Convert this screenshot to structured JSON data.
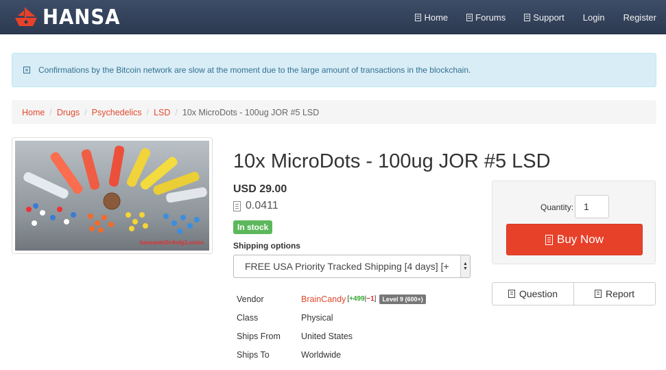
{
  "brand": {
    "name": "HANSA",
    "logo_color": "#e8412a"
  },
  "nav": [
    {
      "label": "Home",
      "icon": "page-icon"
    },
    {
      "label": "Forums",
      "icon": "page-icon"
    },
    {
      "label": "Support",
      "icon": "page-icon"
    },
    {
      "label": "Login"
    },
    {
      "label": "Register"
    }
  ],
  "alert": {
    "text": "Confirmations by the Bitcoin network are slow at the moment due to the large amount of transactions in the blockchain.",
    "icon": "info-icon"
  },
  "breadcrumb": [
    "Home",
    "Drugs",
    "Psychedelics",
    "LSD",
    "10x MicroDots - 100ug JOR #5 LSD"
  ],
  "product": {
    "image_watermark": "hansamkt2rr6nfg3.onion",
    "title": "10x MicroDots - 100ug JOR #5 LSD",
    "price_usd": "USD 29.00",
    "price_btc": "0.0411",
    "stock_badge": "In stock",
    "shipping_label": "Shipping options",
    "shipping_selected": "FREE USA Priority Tracked Shipping [4 days] [+",
    "details": {
      "vendor_key": "Vendor",
      "vendor_name": "BrainCandy",
      "fb_open": "[",
      "fb_pos": "+499",
      "fb_sep": "|",
      "fb_neg": "−1",
      "fb_close": "]",
      "vendor_level": "Level 9 (600+)",
      "class_key": "Class",
      "class_val": "Physical",
      "from_key": "Ships From",
      "from_val": "United States",
      "to_key": "Ships To",
      "to_val": "Worldwide"
    }
  },
  "buy": {
    "qty_label": "Quantity:",
    "qty_value": "1",
    "buy_label": "Buy Now",
    "question_label": "Question",
    "report_label": "Report"
  },
  "colors": {
    "accent": "#e8412a",
    "navbar": "#34425b",
    "success": "#5cb85c",
    "alert_bg": "#d9edf7"
  }
}
